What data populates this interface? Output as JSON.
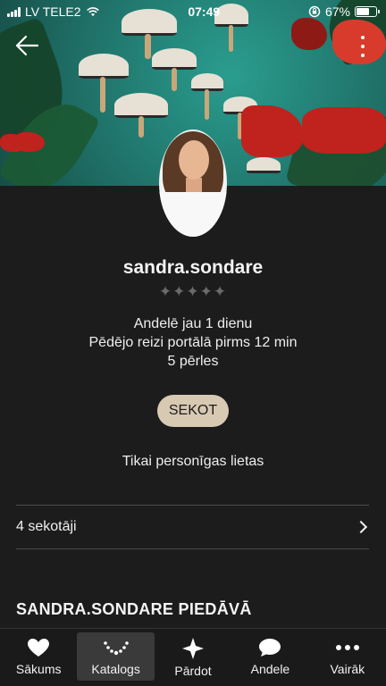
{
  "status_bar": {
    "carrier": "LV TELE2",
    "time": "07:49",
    "battery": "67%",
    "battery_level": 0.67
  },
  "profile": {
    "username": "sandra.sondare",
    "rating_stars": "✦✦✦✦✦",
    "info_lines": [
      "Andelē jau 1 dienu",
      "Pēdējo reizi portālā pirms 12 min",
      "5 pērles"
    ],
    "follow_label": "SEKOT",
    "note": "Tikai personīgas lietas",
    "followers_label": "4 sekotāji",
    "section_title": "SANDRA.SONDARE PIEDĀVĀ"
  },
  "tabbar": {
    "items": [
      {
        "label": "Sākums",
        "icon": "heart-icon",
        "active": false
      },
      {
        "label": "Katalogs",
        "icon": "necklace-icon",
        "active": true
      },
      {
        "label": "Pārdot",
        "icon": "sparkle-icon",
        "active": false
      },
      {
        "label": "Andele",
        "icon": "chat-bubble-icon",
        "active": false
      },
      {
        "label": "Vairāk",
        "icon": "more-dots-icon",
        "active": false
      }
    ]
  },
  "colors": {
    "background": "#1c1c1c",
    "follow_button": "#d8c9b3",
    "cover_teal": "#2a9d8f"
  }
}
